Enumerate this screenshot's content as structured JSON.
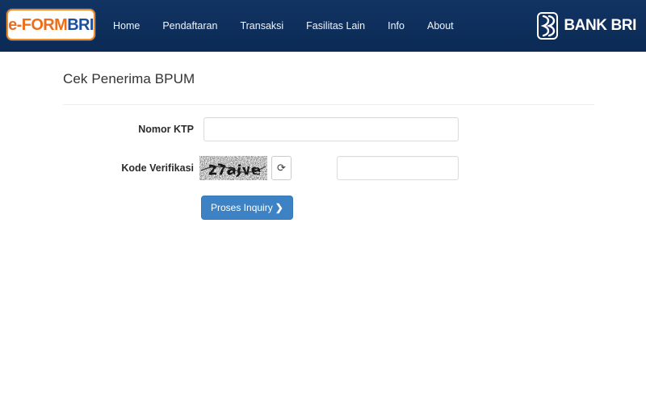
{
  "header": {
    "brand": {
      "part_e": "e-",
      "part_form": "FORM",
      "part_bri": "BRI",
      "accent_border": "#f08c2a",
      "orange": "#ee6d1b",
      "blue": "#1b4fa0"
    },
    "background_color": "#0c2f5e",
    "nav_items": [
      {
        "label": "Home"
      },
      {
        "label": "Pendaftaran"
      },
      {
        "label": "Transaksi"
      },
      {
        "label": "Fasilitas Lain"
      },
      {
        "label": "Info"
      },
      {
        "label": "About"
      }
    ],
    "bank_logo": {
      "icon": "bri-mark-icon",
      "text": "BANK BRI"
    }
  },
  "main": {
    "page_title": "Cek Penerima BPUM",
    "form": {
      "ktp": {
        "label": "Nomor KTP",
        "value": "",
        "placeholder": ""
      },
      "captcha": {
        "label": "Kode Verifikasi",
        "image_text": "27ajve",
        "refresh_icon": "refresh-icon",
        "refresh_glyph": "⟳",
        "value": "",
        "placeholder": ""
      },
      "submit": {
        "label": "Proses Inquiry",
        "caret": "❯",
        "color": "#3c82c4"
      }
    }
  }
}
